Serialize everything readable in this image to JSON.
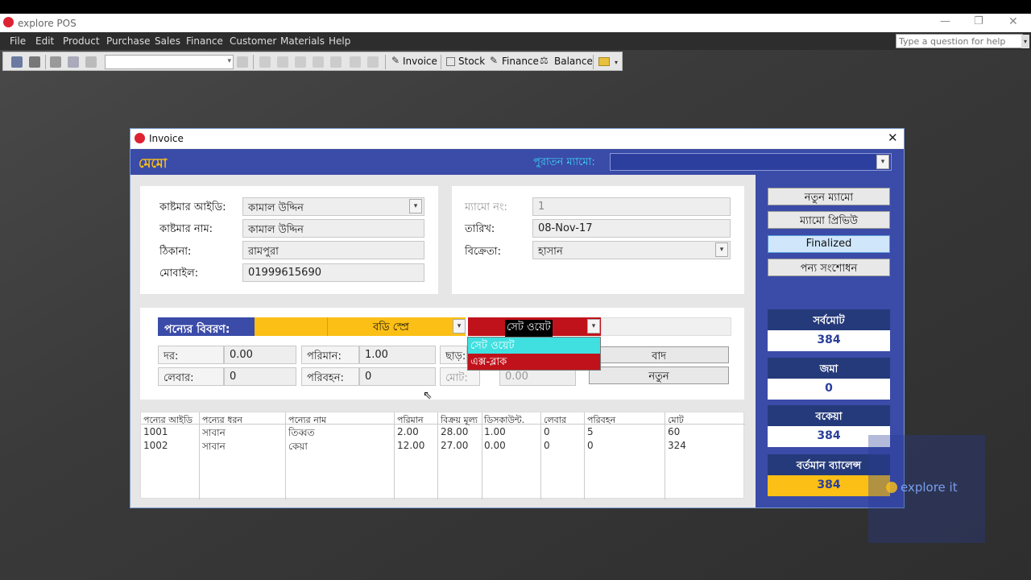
{
  "app": {
    "title": "explore POS",
    "window_controls": [
      "—",
      "❐",
      "✕"
    ]
  },
  "menu": [
    "File",
    "Edit",
    "Product",
    "Purchase",
    "Sales",
    "Finance",
    "Customer",
    "Materials",
    "Help"
  ],
  "help_search": {
    "placeholder": "Type a question for help"
  },
  "toolbar": {
    "invoice": "Invoice",
    "stock": "Stock",
    "finance": "Finance",
    "balance": "Balance"
  },
  "invoice_window": {
    "title": "Invoice",
    "memo_label": "মেমো",
    "old_memo_label": "পুরাতন ম্যামো:",
    "customer": {
      "id_label": "কাষ্টমার আইডি:",
      "id_value": "কামাল উদ্দিন",
      "name_label": "কাষ্টমার নাম:",
      "name_value": "কামাল উদ্দিন",
      "address_label": "ঠিকানা:",
      "address_value": "রামপুরা",
      "mobile_label": "মোবাইল:",
      "mobile_value": "01999615690"
    },
    "memo_info": {
      "memo_no_label": "ম্যামো নং:",
      "memo_no_value": "1",
      "date_label": "তারিখ:",
      "date_value": "08-Nov-17",
      "seller_label": "বিক্রেতা:",
      "seller_value": "হাসান"
    },
    "product": {
      "details_label": "পন্যের বিবরণ:",
      "category_value": "বডি স্প্রে",
      "name_value": "সেট ওয়েট",
      "dropdown_options": [
        "সেট ওয়েট",
        "এক্স-ব্লাক"
      ],
      "rate_label": "দর:",
      "rate_value": "0.00",
      "qty_label": "পরিমান:",
      "qty_value": "1.00",
      "discount_label": "ছাড়:",
      "labour_label": "লেবার:",
      "labour_value": "0",
      "transport_label": "পরিবহন:",
      "transport_value": "0",
      "total_label": "মোট:",
      "total_value": "0.00",
      "remove_button": "বাদ",
      "new_button": "নতুন"
    },
    "grid": {
      "headers": [
        "পন্যের আইডি",
        "পন্যের ধরন",
        "পন্যের নাম",
        "পরিমান",
        "বিক্রয় মূল্য",
        "ডিসকাউন্ট.",
        "লেবার",
        "পরিবহন",
        "মোট"
      ],
      "rows": [
        [
          "1001",
          "সাবান",
          "তিব্বত",
          "2.00",
          "28.00",
          "1.00",
          "0",
          "5",
          "60"
        ],
        [
          "1002",
          "সাবান",
          "কেয়া",
          "12.00",
          "27.00",
          "0.00",
          "0",
          "0",
          "324"
        ]
      ]
    },
    "actions": {
      "new_memo": "নতুন ম্যামো",
      "memo_preview": "ম্যামো প্রিভিউ",
      "finalized": "Finalized",
      "product_edit": "পন্য সংশোধন"
    },
    "summary": {
      "grand_total_label": "সর্বমোট",
      "grand_total_value": "384",
      "deposit_label": "জমা",
      "deposit_value": "0",
      "due_label": "বকেয়া",
      "due_value": "384",
      "balance_label": "বর্তমান ব্যালেন্স",
      "balance_value": "384"
    }
  },
  "watermark": {
    "brand": "explore it"
  },
  "colors": {
    "accent_blue": "#3a4ba8",
    "yellow": "#fbbf16",
    "red": "#c0121b",
    "cyan": "#40e0e0"
  }
}
